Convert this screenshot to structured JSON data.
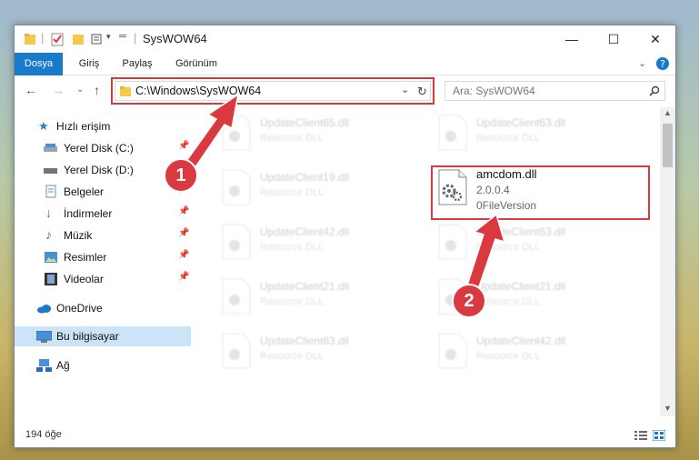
{
  "window": {
    "title": "SysWOW64",
    "controls": [
      "—",
      "☐",
      "✕"
    ]
  },
  "ribbon": {
    "tabs": [
      "Dosya",
      "Giriş",
      "Paylaş",
      "Görünüm"
    ]
  },
  "navigation": {
    "address": "C:\\Windows\\SysWOW64",
    "search_placeholder": "Ara: SysWOW64"
  },
  "sidebar": {
    "items": [
      {
        "label": "Hızlı erişim",
        "icon": "star-icon"
      },
      {
        "label": "Yerel Disk (C:)",
        "icon": "drive-icon"
      },
      {
        "label": "Yerel Disk (D:)",
        "icon": "drive-icon"
      },
      {
        "label": "Belgeler",
        "icon": "documents-icon"
      },
      {
        "label": "İndirmeler",
        "icon": "download-icon"
      },
      {
        "label": "Müzik",
        "icon": "music-icon"
      },
      {
        "label": "Resimler",
        "icon": "pictures-icon"
      },
      {
        "label": "Videolar",
        "icon": "videos-icon"
      },
      {
        "label": "OneDrive",
        "icon": "cloud-icon"
      },
      {
        "label": "Bu bilgisayar",
        "icon": "computer-icon"
      },
      {
        "label": "Ağ",
        "icon": "network-icon"
      }
    ]
  },
  "files": {
    "background": [
      {
        "name": "UpdateClient65.dll",
        "type": "Resource DLL"
      },
      {
        "name": "UpdateClient63.dll",
        "type": "Resource DLL"
      },
      {
        "name": "UpdateClient19.dll",
        "type": "Resource DLL"
      },
      {
        "name": "UpdateClient42.dll",
        "type": "Resource DLL"
      },
      {
        "name": "UpdateClient63.dll",
        "type": "Resource DLL"
      },
      {
        "name": "UpdateClient21.dll",
        "type": "Resource DLL"
      },
      {
        "name": "UpdateClient21.dll",
        "type": "Resource DLL"
      },
      {
        "name": "UpdateClient63.dll",
        "type": "Resource DLL"
      },
      {
        "name": "UpdateClient42.dll",
        "type": "Resource DLL"
      }
    ],
    "highlighted": {
      "name": "amcdom.dll",
      "version": "2.0.0.4",
      "description": "0FileVersion"
    }
  },
  "annotations": {
    "step1": "1",
    "step2": "2",
    "color": "#d9393f"
  },
  "status": {
    "item_count": "194 öğe"
  }
}
